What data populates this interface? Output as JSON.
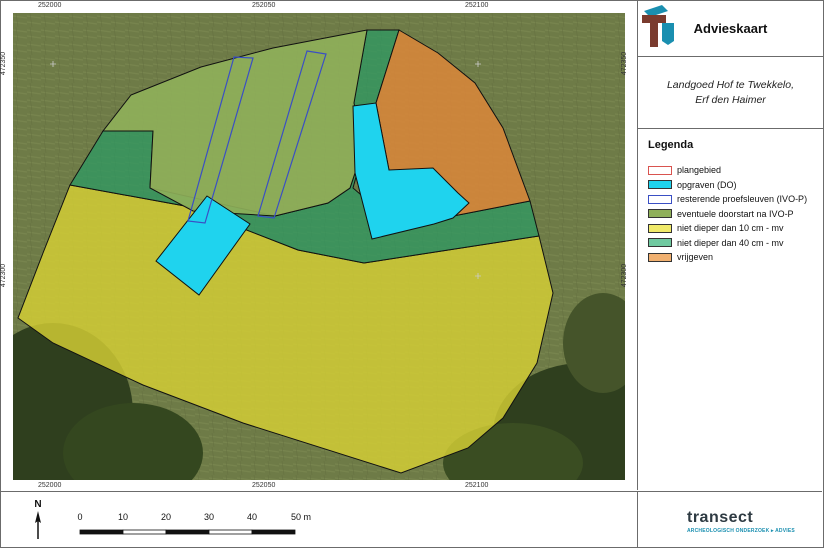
{
  "map": {
    "coords_top": [
      "252000",
      "252050",
      "252100"
    ],
    "coords_bottom": [
      "252000",
      "252050",
      "252100"
    ],
    "coords_left": [
      "472350",
      "472300"
    ],
    "coords_right": [
      "472350",
      "472300"
    ]
  },
  "panel": {
    "title": "Advieskaart",
    "subtitle_line1": "Landgoed Hof te Twekkelo,",
    "subtitle_line2": "Erf den Haimer",
    "legend_title": "Legenda",
    "legend": [
      {
        "label": "plangebied",
        "fill": "#ffffff",
        "stroke": "#d9534f"
      },
      {
        "label": "opgraven (DO)",
        "fill": "#1fd3ee",
        "stroke": "#333333"
      },
      {
        "label": "resterende proefsleuven (IVO-P)",
        "fill": "#ffffff",
        "stroke": "#3a4fc4"
      },
      {
        "label": "eventuele doorstart na IVO-P",
        "fill": "#8fb05a",
        "stroke": "#333333"
      },
      {
        "label": "niet dieper dan 10 cm - mv",
        "fill": "#f0ea6a",
        "stroke": "#333333"
      },
      {
        "label": "niet dieper dan 40 cm - mv",
        "fill": "#6fc9a0",
        "stroke": "#333333"
      },
      {
        "label": "vrijgeven",
        "fill": "#f0b070",
        "stroke": "#333333"
      }
    ]
  },
  "scale": {
    "labels": [
      "0",
      "10",
      "20",
      "30",
      "40",
      "50 m"
    ]
  },
  "north_label": "N",
  "logo": {
    "name": "transect",
    "tagline": "ARCHEOLOGISCH ONDERZOEK ▸ ADVIES"
  },
  "colors": {
    "opgraven": "#1fd3ee",
    "doorstart": "#8fb05a",
    "dieper10": "#d9d633",
    "dieper40": "#2e9a63",
    "vrijgeven": "#d8863a",
    "proefsleuven": "#3a4fc4"
  }
}
